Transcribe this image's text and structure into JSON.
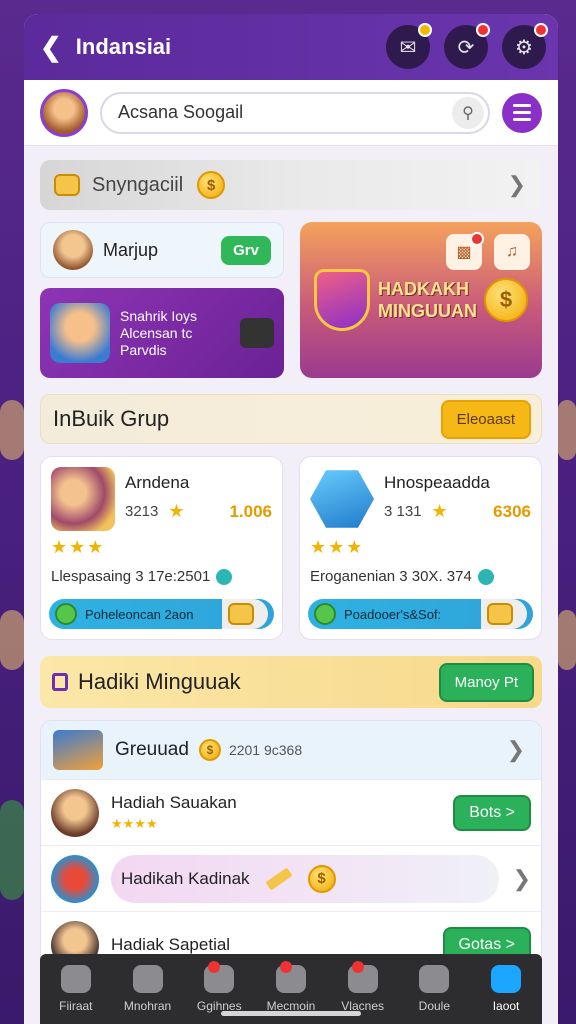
{
  "header": {
    "title": "Indansiai"
  },
  "search": {
    "value": "Acsana Soogail"
  },
  "banner": {
    "label": "Snyngaciil"
  },
  "card_small": {
    "title": "Marjup",
    "button": "Grv"
  },
  "purple_card": {
    "line1": "Snahrik Ioys",
    "line2": "Alcensan tc",
    "line3": "Parvdis"
  },
  "promo": {
    "line1": "HADKAKH",
    "line2": "MINGUUAN"
  },
  "section1": {
    "title": "InBuik Grup",
    "button": "Eleoaast"
  },
  "groups": [
    {
      "name": "Arndena",
      "stat": "3213",
      "gold": "1.006",
      "meta": "Llespasaing 3 17e:2501",
      "bar": "Poheleoncan 2aon"
    },
    {
      "name": "Hnospeaadda",
      "stat": "3 131",
      "gold": "6306",
      "meta": "Eroganenian 3 30X. 374",
      "bar": "Poadooer's&Sof:"
    }
  ],
  "section2": {
    "title": "Hadiki Minguuak",
    "button": "Manoy Pt"
  },
  "list": {
    "head": {
      "title": "Greuuad",
      "num": "2201 9c368"
    },
    "items": [
      {
        "title": "Hadiah Sauakan",
        "stars": "★★★★",
        "button": "Bots >"
      },
      {
        "title": "Hadikah Kadinak"
      },
      {
        "title": "Hadiak Sapetial",
        "button": "Gotas >"
      }
    ]
  },
  "nav": [
    {
      "label": "Fiiraat"
    },
    {
      "label": "Mnohran"
    },
    {
      "label": "Ggihnes"
    },
    {
      "label": "Mecmoin"
    },
    {
      "label": "Vlacnes"
    },
    {
      "label": "Doule"
    },
    {
      "label": "Iaoot",
      "active": true
    }
  ]
}
